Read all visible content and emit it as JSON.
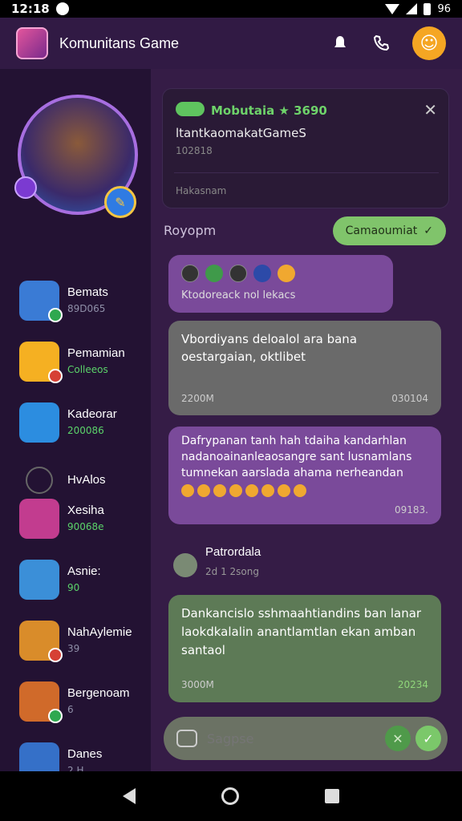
{
  "status": {
    "time": "12:18",
    "battery": "96"
  },
  "header": {
    "title": "Komunitans Game"
  },
  "sidebar": {
    "contacts": [
      {
        "name": "Bemats",
        "sub": "89D065",
        "color": "#3a7bd5",
        "status": "#2fa84f",
        "sub_green": false
      },
      {
        "name": "Pemamian",
        "sub": "Colleeos",
        "color": "#f5b022",
        "status": "#d64035",
        "sub_green": true
      },
      {
        "name": "Kadeorar",
        "sub": "200086",
        "color": "#2c8de0",
        "status": "",
        "sub_green": true
      },
      {
        "name": "HvAlos",
        "sub": "",
        "color": "",
        "status": "",
        "sub_green": false
      },
      {
        "name": "Xesiha",
        "sub": "90068e",
        "color": "#c23c8f",
        "status": "",
        "sub_green": true
      },
      {
        "name": "Asnie:",
        "sub": "90",
        "color": "#3b8fd8",
        "status": "",
        "sub_green": true
      },
      {
        "name": "NahAylemie",
        "sub": "39",
        "color": "#d98c2a",
        "status": "#d64035",
        "sub_green": false
      },
      {
        "name": "Bergenoam",
        "sub": "6",
        "color": "#d06a2a",
        "status": "#2fa84f",
        "sub_green": false
      },
      {
        "name": "Danes",
        "sub": "2 H",
        "color": "#3570c8",
        "status": "",
        "sub_green": false
      }
    ]
  },
  "notice": {
    "title": "Mobutaia ★ 3690",
    "line": "ltantkaomakatGameS",
    "meta": "102818",
    "footer": "Hakasnam"
  },
  "chat": {
    "reply_label": "Royopm",
    "chip_label": "Camaoumiat",
    "msg1": {
      "caption": "Ktodoreack nol lekacs"
    },
    "msg2": {
      "text": "Vbordiyans deloalol ara bana oestargaian, oktlibet",
      "time_l": "2200M",
      "time_r": "030104"
    },
    "msg3": {
      "text": "Dafrypanan tanh hah tdaiha kandarhlan nadanoainanleaosangre sant lusnamlans tumnekan aarslada ahama nerheandan",
      "time_r": "09183."
    },
    "sender": {
      "name": "Patrordala",
      "sub": "2d 1 2song"
    },
    "msg4": {
      "text": "Dankancislo sshmaahtiandins ban lanar laokdkalalin anantlamtlan ekan amban santaol",
      "time_l": "3000M",
      "time_r": "20234"
    },
    "composer_placeholder": "Sagpse"
  }
}
